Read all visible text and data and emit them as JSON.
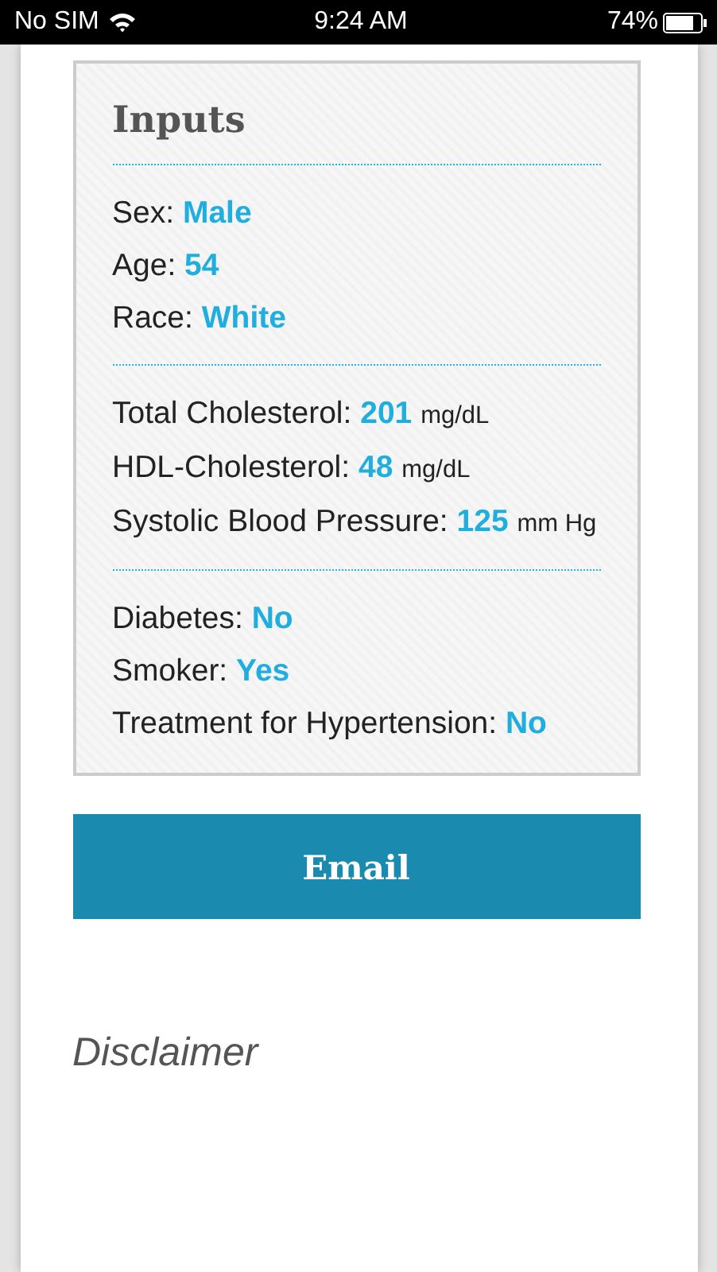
{
  "status_bar": {
    "carrier": "No SIM",
    "time": "9:24 AM",
    "battery": "74%"
  },
  "inputs": {
    "title": "Inputs",
    "groups": [
      [
        {
          "label": "Sex:",
          "value": "Male"
        },
        {
          "label": "Age:",
          "value": "54"
        },
        {
          "label": "Race:",
          "value": "White"
        }
      ],
      [
        {
          "label": "Total Cholesterol:",
          "value": "201",
          "unit": "mg/dL"
        },
        {
          "label": "HDL-Cholesterol:",
          "value": "48",
          "unit": "mg/dL"
        },
        {
          "label": "Systolic Blood Pressure:",
          "value": "125",
          "unit": "mm Hg"
        }
      ],
      [
        {
          "label": "Diabetes:",
          "value": "No"
        },
        {
          "label": "Smoker:",
          "value": "Yes"
        },
        {
          "label": "Treatment for Hypertension:",
          "value": "No"
        }
      ]
    ]
  },
  "email_button": "Email",
  "disclaimer": {
    "title": "Disclaimer"
  }
}
